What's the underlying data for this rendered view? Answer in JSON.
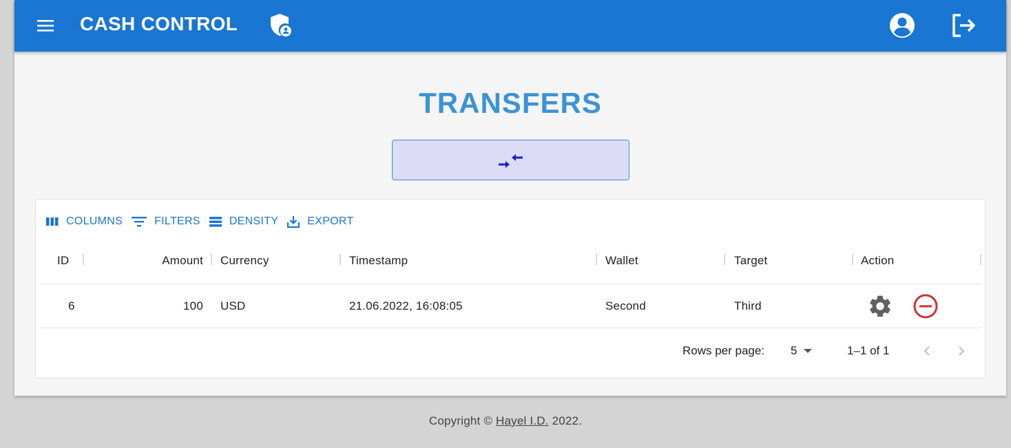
{
  "header": {
    "title": "CASH CONTROL",
    "icons": [
      "menu-icon",
      "shield-user-icon",
      "account-circle-icon",
      "logout-icon"
    ]
  },
  "page": {
    "title": "TRANSFERS",
    "action_icon": "compare-arrows-icon"
  },
  "toolbar": {
    "columns": "COLUMNS",
    "filters": "FILTERS",
    "density": "DENSITY",
    "export": "EXPORT"
  },
  "table": {
    "columns": [
      "ID",
      "Amount",
      "Currency",
      "Timestamp",
      "Wallet",
      "Target",
      "Action"
    ],
    "rows": [
      {
        "id": "6",
        "amount": "100",
        "currency": "USD",
        "timestamp": "21.06.2022, 16:08:05",
        "wallet": "Second",
        "target": "Third"
      }
    ]
  },
  "pagination": {
    "rows_per_page_label": "Rows per page:",
    "rows_per_page": "5",
    "range": "1–1 of 1"
  },
  "footer": {
    "prefix": "Copyright © ",
    "author": "Hayel I.D.",
    "suffix": " 2022."
  },
  "colors": {
    "primary": "#1976d2",
    "title": "#3b93d6",
    "delete": "#d32f2f",
    "button_bg": "#dcdcf7"
  }
}
